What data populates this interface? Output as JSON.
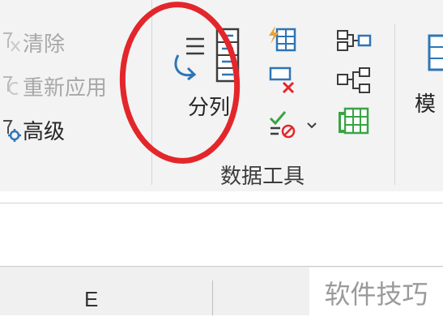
{
  "ribbon": {
    "sort_filter": {
      "clear": "清除",
      "reapply": "重新应用",
      "advanced": "高级"
    },
    "data_tools": {
      "text_to_columns": "分列",
      "group_label": "数据工具"
    },
    "model": "模"
  },
  "grid": {
    "column_header": "E"
  },
  "watermark": "软件技巧",
  "colors": {
    "accent_blue": "#2f75b5",
    "annotation_red": "#e3262b",
    "green": "#3aa345"
  },
  "icons": {
    "clear": "filter-clear-icon",
    "reapply": "filter-reapply-icon",
    "advanced": "filter-advanced-icon",
    "text_to_columns": "text-to-columns-icon",
    "flash_fill": "flash-fill-icon",
    "remove_duplicates": "remove-duplicates-icon",
    "data_validation": "data-validation-icon",
    "consolidate": "consolidate-icon",
    "relationships": "relationships-icon",
    "manage_data_model": "data-model-icon"
  }
}
